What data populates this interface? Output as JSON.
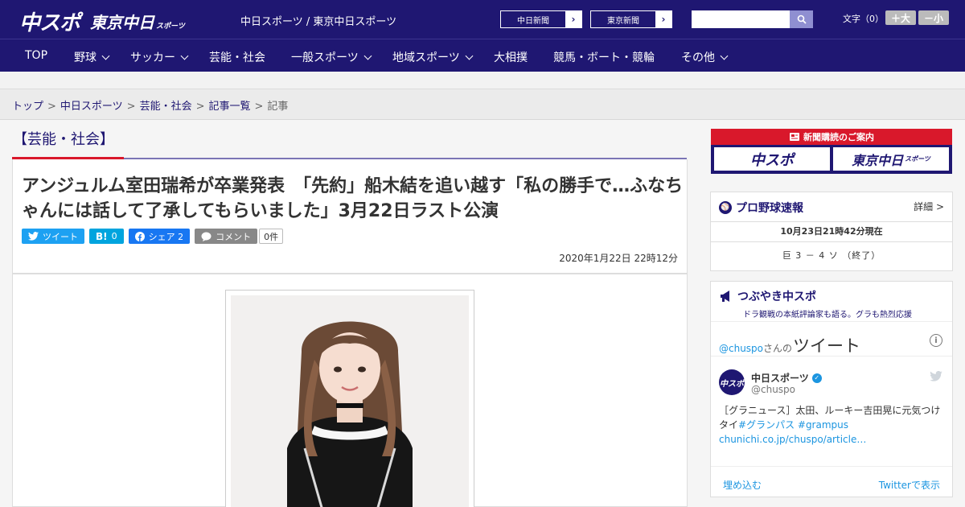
{
  "header": {
    "logo_chuspo": "中スポ",
    "logo_tokyo": "東京中日",
    "logo_tokyo_sub": "スポーツ",
    "site_names": "中日スポーツ / 東京中日スポーツ",
    "paper_links": [
      "中日新聞",
      "東京新聞"
    ],
    "search_placeholder": "",
    "font_size_label": "文字（0）",
    "font_increase": "＋大",
    "font_decrease": "－小"
  },
  "nav": {
    "items": [
      {
        "label": "TOP"
      },
      {
        "label": "野球"
      },
      {
        "label": "サッカー"
      },
      {
        "label": "芸能・社会"
      },
      {
        "label": "一般スポーツ"
      },
      {
        "label": "地域スポーツ"
      },
      {
        "label": "大相撲"
      },
      {
        "label": "競馬・ボート・競輪"
      },
      {
        "label": "その他"
      }
    ]
  },
  "breadcrumb": {
    "items": [
      "トップ",
      "中日スポーツ",
      "芸能・社会",
      "記事一覧"
    ],
    "current": "記事"
  },
  "article": {
    "category": "【芸能・社会】",
    "title": "アンジュルム室田瑞希が卒業発表　「先約」船木結を追い越す「私の勝手で…ふなちゃんには話して了承してもらいました」3月22日ラスト公演",
    "share": {
      "tweet": "ツイート",
      "hatena_icon": "B!",
      "hatena_count": "0",
      "facebook": "シェア 2",
      "comment": "コメント",
      "comment_count": "0件"
    },
    "date": "2020年1月22日 22時12分"
  },
  "sidebar": {
    "subscribe": {
      "title": "新聞購読のご案内",
      "logo_chuspo": "中スポ",
      "logo_tokyo": "東京中日",
      "logo_tokyo_sub": "スポーツ"
    },
    "baseball": {
      "title": "プロ野球速報",
      "more": "詳細 >",
      "updated": "10月23日21時42分現在",
      "score": "巨 3 － 4 ソ （終了）"
    },
    "twitter_widget": {
      "title": "つぶやき中スポ",
      "subtitle": "ドラ観戦の本紙評論家も語る。グラも熱烈応援",
      "user_link": "@chuspo",
      "user_suffix": "さんの",
      "user_tail": "ツイート",
      "account_name": "中日スポーツ",
      "account_handle": "@chuspo",
      "tweet_text": "［グラニュース］太田、ルーキー吉田晃に元気つけタイ",
      "tweet_tags": "#グランパス #grampus",
      "tweet_link": "chunichi.co.jp/chuspo/article…",
      "embed": "埋め込む",
      "view_on_twitter": "Twitterで表示"
    }
  },
  "colors": {
    "brand_navy": "#1f1772",
    "accent_red": "#d9182b",
    "twitter_blue": "#1da1f2",
    "hatena_blue": "#00a4de",
    "facebook_blue": "#1877f2",
    "comment_gray": "#888888"
  }
}
